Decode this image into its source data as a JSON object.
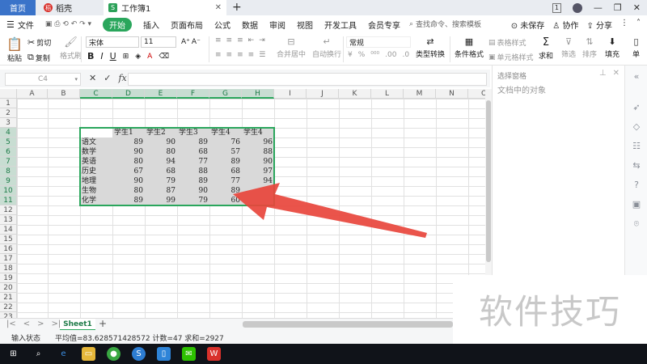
{
  "tabs": {
    "home": "首页",
    "daoke": "稻壳",
    "workbook": "工作簿1"
  },
  "menus": [
    "开始",
    "插入",
    "页面布局",
    "公式",
    "数据",
    "审阅",
    "视图",
    "开发工具",
    "会员专享"
  ],
  "file_menu": "文件",
  "search_placeholder": "查找命令、搜索模板",
  "menu_right": {
    "unsaved": "未保存",
    "collab": "协作",
    "share": "分享"
  },
  "ribbon": {
    "paste": "粘贴",
    "cut": "剪切",
    "copy": "复制",
    "format_painter": "格式刷",
    "font_name": "宋体",
    "font_size": "11",
    "merge_center": "合并居中",
    "auto_wrap": "自动换行",
    "number_format": "常规",
    "type_convert": "类型转换",
    "conditional_format": "条件格式",
    "table_style": "表格样式",
    "cell_style": "单元格样式",
    "sum": "求和",
    "filter": "筛选",
    "sort": "排序",
    "fill": "填充",
    "single": "单"
  },
  "formula": {
    "cell_ref": "C4",
    "content": ""
  },
  "columns": [
    "A",
    "B",
    "C",
    "D",
    "E",
    "F",
    "G",
    "H",
    "I",
    "J",
    "K",
    "L",
    "M",
    "N",
    "O"
  ],
  "rows": [
    "1",
    "2",
    "3",
    "4",
    "5",
    "6",
    "7",
    "8",
    "9",
    "10",
    "11",
    "12",
    "13",
    "14",
    "15",
    "16",
    "17",
    "18",
    "19",
    "20",
    "21",
    "22",
    "23"
  ],
  "table": {
    "headers": [
      "",
      "学生1",
      "学生2",
      "学生3",
      "学生4",
      "学生4"
    ],
    "rows": [
      {
        "subject": "语文",
        "values": [
          89,
          90,
          89,
          76,
          96
        ]
      },
      {
        "subject": "数学",
        "values": [
          90,
          80,
          68,
          57,
          88
        ]
      },
      {
        "subject": "英语",
        "values": [
          80,
          94,
          77,
          89,
          90
        ]
      },
      {
        "subject": "历史",
        "values": [
          67,
          68,
          88,
          68,
          97
        ]
      },
      {
        "subject": "地理",
        "values": [
          90,
          79,
          89,
          77,
          94
        ]
      },
      {
        "subject": "生物",
        "values": [
          80,
          87,
          90,
          89,
          ""
        ]
      },
      {
        "subject": "化学",
        "values": [
          89,
          99,
          79,
          60,
          ""
        ]
      }
    ]
  },
  "sheet": {
    "name": "Sheet1"
  },
  "status": {
    "mode": "输入状态",
    "summary": "平均值=83.628571428572 计数=47 求和=2927"
  },
  "side_panel": {
    "header": "选择窗格",
    "title": "文档中的对象"
  },
  "watermark": "软件技巧",
  "colors": {
    "accent": "#2aa65c",
    "selection_fill": "#d9d9d9",
    "arrow": "#e8453c"
  }
}
